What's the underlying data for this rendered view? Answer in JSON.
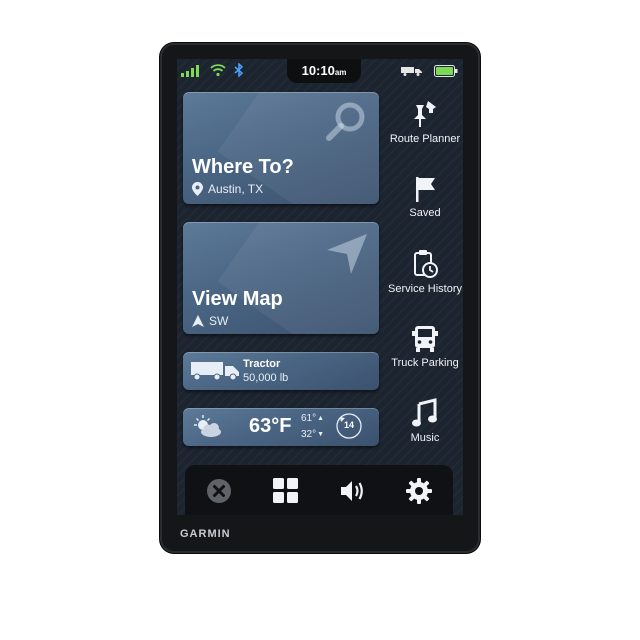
{
  "status": {
    "time": "10:10",
    "ampm": "am"
  },
  "cards": {
    "where_to": {
      "title": "Where To?",
      "location": "Austin, TX"
    },
    "view_map": {
      "title": "View Map",
      "heading": "SW"
    },
    "vehicle": {
      "name": "Tractor",
      "weight": "50,000 lb"
    },
    "weather": {
      "temp": "63°F",
      "high": "61°",
      "low": "32°",
      "wind": "14"
    }
  },
  "rail": {
    "items": [
      {
        "label": "Route Planner",
        "icon": "route-planner-icon"
      },
      {
        "label": "Saved",
        "icon": "flag-icon"
      },
      {
        "label": "Service History",
        "icon": "service-history-icon"
      },
      {
        "label": "Truck Parking",
        "icon": "truck-icon"
      },
      {
        "label": "Music",
        "icon": "music-note-icon"
      }
    ]
  },
  "dock": {
    "items": [
      "close-icon",
      "apps-grid-icon",
      "volume-icon",
      "gear-icon"
    ]
  },
  "brand": {
    "name": "GARMIN"
  },
  "colors": {
    "card": "#4a6584",
    "screen": "#1c2430",
    "signal": "#7ed957",
    "wifi": "#7ed957",
    "bluetooth": "#4aa3ff",
    "battery": "#7ed957"
  }
}
